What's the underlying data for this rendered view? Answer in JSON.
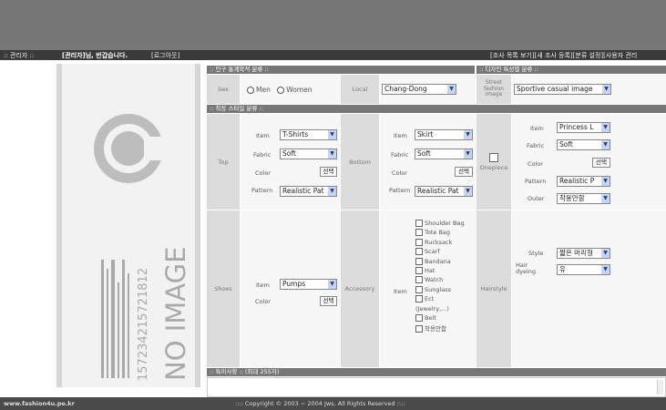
{
  "menubar": {
    "left_title": ":: 관리자 ::",
    "greeting": "[관리자]님, 반갑습니다.",
    "logout": "[로그아웃]",
    "right_links": "[조사 목록 보기][새 조사 등록][분류 설정][사용자 관리"
  },
  "image_panel": {
    "barcode_text": "157234215721812",
    "no_image_text": "NO IMAGE"
  },
  "demographics": {
    "header": ":: 인구 통계학적 분류 ::",
    "sex_label": "Sex",
    "sex_options": [
      "Men",
      "Women"
    ],
    "local_label": "Local",
    "local_value": "Chang-Dong"
  },
  "design": {
    "header": ":: 디자인 특성별 분류 ::",
    "street_label": "Street fashion image",
    "street_value": "Sportive casual image"
  },
  "wear_style": {
    "header": ":: 착장 스타일 분류 ::",
    "top": {
      "label": "Top",
      "item_label": "Item",
      "item_value": "T-Shirts",
      "fabric_label": "Fabric",
      "fabric_value": "Soft",
      "color_label": "Color",
      "color_button": "선택",
      "pattern_label": "Pattern",
      "pattern_value": "Realistic Pat"
    },
    "bottom": {
      "label": "Bottom",
      "item_label": "Item",
      "item_value": "Skirt",
      "fabric_label": "Fabric",
      "fabric_value": "Soft",
      "color_label": "Color",
      "color_button": "선택",
      "pattern_label": "Pattern",
      "pattern_value": "Realistic Pat"
    },
    "onepiece_label": "Onepiece",
    "onepiece": {
      "item_label": "Item",
      "item_value": "Princess L",
      "fabric_label": "Fabric",
      "fabric_value": "Soft",
      "color_label": "Color",
      "color_button": "선택",
      "pattern_label": "Pattern",
      "pattern_value": "Realistic P",
      "outer_label": "Outer",
      "outer_value": "착용안함"
    },
    "shoes": {
      "label": "Shoes",
      "item_label": "Item",
      "item_value": "Pumps",
      "color_label": "Color",
      "color_button": "선택"
    },
    "accessory": {
      "label": "Accessory",
      "item_label": "Item",
      "items": [
        "Shoulder Bag",
        "Tote Bag",
        "Rucksack",
        "Scarf",
        "Bandana",
        "Hat",
        "Watch",
        "Sunglass",
        "Ect",
        "(Jewelry,...)",
        "Belt",
        "착용안함"
      ]
    },
    "hairstyle": {
      "label": "Hairstyle",
      "style_label": "Style",
      "style_value": "짧은 머리형",
      "dyeing_label": "Hair dyeing",
      "dyeing_value": "유"
    }
  },
  "notes": {
    "header": ":: 특이사항 :: (최대 255자)"
  },
  "footer": {
    "site": "www.fashion4u.pe.kr",
    "copyright": ":::: Copyright © 2003 ~ 2004 Jws, All Rights Reserved ::::"
  }
}
